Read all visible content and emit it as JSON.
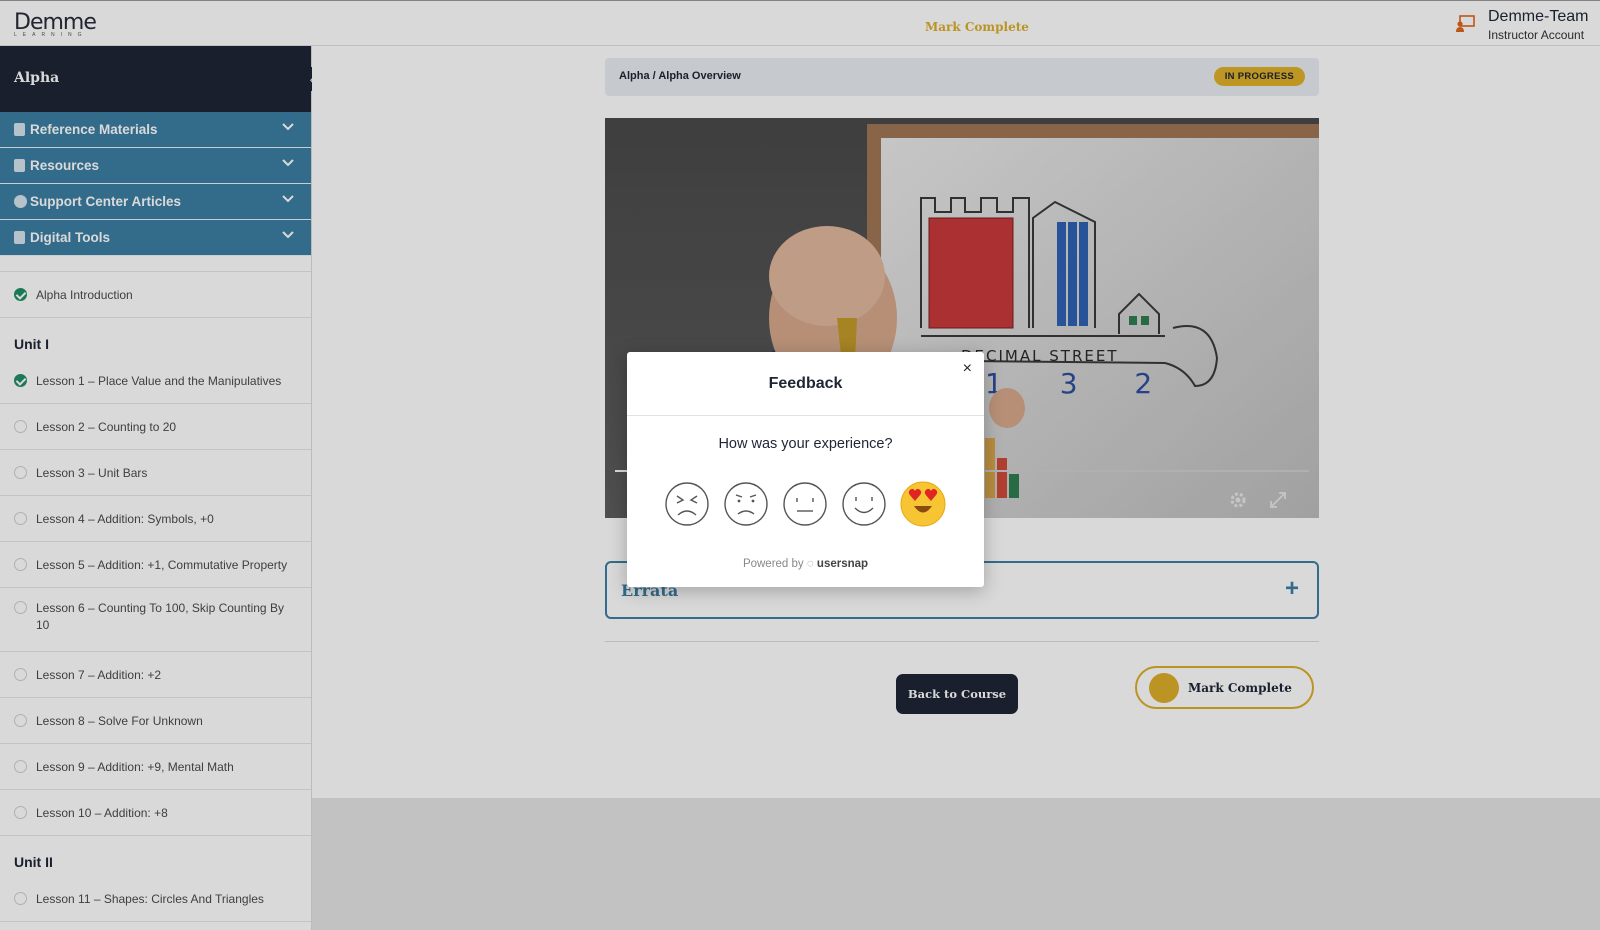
{
  "header": {
    "logo_text": "Demme",
    "logo_sub": "LEARNING",
    "mark_complete": "Mark Complete",
    "account_name": "Demme-Team",
    "account_role": "Instructor Account"
  },
  "sidebar": {
    "title": "Alpha",
    "accordions": [
      {
        "label": "Reference Materials",
        "icon": "book-icon"
      },
      {
        "label": "Resources",
        "icon": "clipboard-icon"
      },
      {
        "label": "Support Center Articles",
        "icon": "help-icon"
      },
      {
        "label": "Digital Tools",
        "icon": "cube-icon"
      }
    ],
    "intro": {
      "label": "Alpha Introduction",
      "done": true
    },
    "units": [
      {
        "title": "Unit I",
        "lessons": [
          {
            "label": "Lesson 1 – Place Value and the Manipulatives",
            "done": true
          },
          {
            "label": "Lesson 2 – Counting to 20",
            "done": false
          },
          {
            "label": "Lesson 3 – Unit Bars",
            "done": false
          },
          {
            "label": "Lesson 4 – Addition: Symbols, +0",
            "done": false
          },
          {
            "label": "Lesson 5 – Addition: +1, Commutative Property",
            "done": false
          },
          {
            "label": "Lesson 6 – Counting To 100, Skip Counting By 10",
            "done": false
          },
          {
            "label": "Lesson 7 – Addition: +2",
            "done": false
          },
          {
            "label": "Lesson 8 – Solve For Unknown",
            "done": false
          },
          {
            "label": "Lesson 9 – Addition: +9, Mental Math",
            "done": false
          },
          {
            "label": "Lesson 10 – Addition: +8",
            "done": false
          }
        ]
      },
      {
        "title": "Unit II",
        "lessons": [
          {
            "label": "Lesson 11 – Shapes: Circles And Triangles",
            "done": false
          }
        ]
      }
    ]
  },
  "main": {
    "breadcrumb": "Alpha / Alpha Overview",
    "status_badge": "IN PROGRESS",
    "video_board_text": "DECIMAL STREET",
    "video_digits": "1  3  2",
    "errata_label": "Errata",
    "back_button": "Back to Course",
    "mark_complete_button": "Mark Complete"
  },
  "feedback_modal": {
    "title": "Feedback",
    "close": "×",
    "question": "How was your experience?",
    "ratings": [
      "very-dissatisfied",
      "dissatisfied",
      "neutral",
      "satisfied",
      "very-satisfied"
    ],
    "selected": "very-satisfied",
    "powered_prefix": "Powered by",
    "powered_brand": "usersnap"
  },
  "colors": {
    "navy": "#1e2535",
    "teal": "#3d7fa4",
    "gold": "#dcae2b",
    "green": "#1f8f65"
  }
}
